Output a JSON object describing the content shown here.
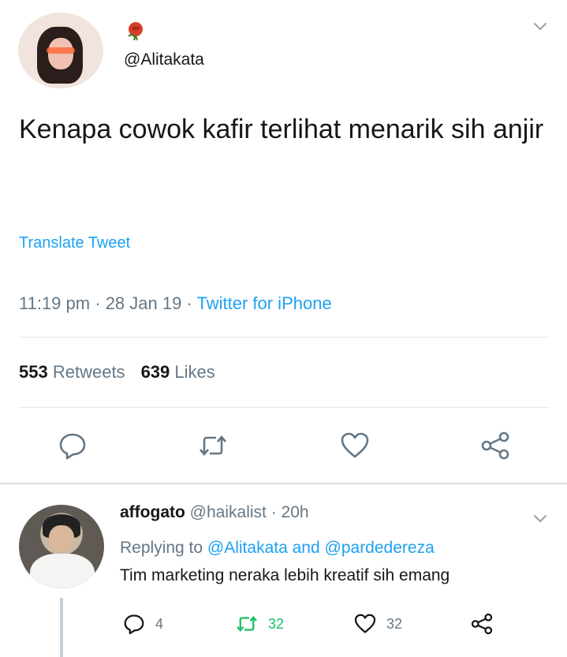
{
  "tweet": {
    "handle": "@Alitakata",
    "text": "Kenapa cowok kafir terlihat menarik sih anjir",
    "translate_label": "Translate Tweet",
    "time": "11:19 pm",
    "date": "28 Jan 19",
    "source": "Twitter for iPhone",
    "retweet_count": "553",
    "retweets_label": "Retweets",
    "like_count": "639",
    "likes_label": "Likes"
  },
  "reply": {
    "name": "affogato",
    "handle": "@haikalist",
    "age": "20h",
    "replying_prefix": "Replying to",
    "replying_to_1": "@Alitakata",
    "replying_and": "and",
    "replying_to_2": "@pardedereza",
    "text": "Tim marketing neraka lebih kreatif sih emang",
    "reply_count": "4",
    "retweet_count": "32",
    "like_count": "32"
  },
  "icons": {
    "reply": "reply-icon",
    "retweet": "retweet-icon",
    "like": "heart-icon",
    "share": "share-icon",
    "more": "chevron-down-icon",
    "flair": "rose-icon"
  },
  "colors": {
    "link": "#1da1f2",
    "secondary_text": "#657786",
    "retweet_active": "#17bf63"
  }
}
